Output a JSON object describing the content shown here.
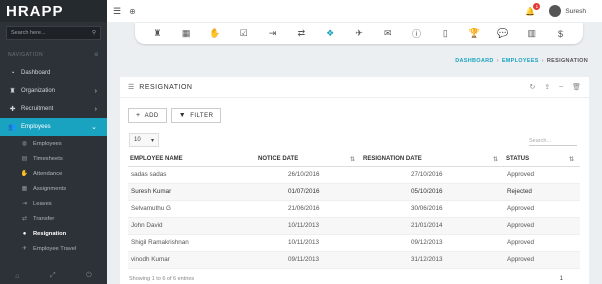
{
  "app": {
    "brand": "HRAPP"
  },
  "sidebar": {
    "search_placeholder": "Search here...",
    "nav_header": "NAVIGATION",
    "items": [
      {
        "label": "Dashboard"
      },
      {
        "label": "Organization"
      },
      {
        "label": "Recruitment"
      },
      {
        "label": "Employees"
      }
    ],
    "sub_items": [
      {
        "label": "Employees"
      },
      {
        "label": "Timesheets"
      },
      {
        "label": "Attendance"
      },
      {
        "label": "Assignments"
      },
      {
        "label": "Leaves"
      },
      {
        "label": "Transfer"
      },
      {
        "label": "Resignation"
      },
      {
        "label": "Employee Travel"
      }
    ]
  },
  "topbar": {
    "user_name": "Suresh",
    "notification_count": "1"
  },
  "breadcrumb": {
    "home": "DASHBOARD",
    "section": "EMPLOYEES",
    "current": "RESIGNATION"
  },
  "card": {
    "title": "RESIGNATION",
    "add_label": "ADD",
    "filter_label": "FILTER",
    "page_length": "10",
    "search_placeholder": "Search..."
  },
  "table": {
    "headers": [
      "EMPLOYEE NAME",
      "NOTICE DATE",
      "RESIGNATION DATE",
      "STATUS"
    ],
    "rows": [
      [
        "sadas sadas",
        "26/10/2016",
        "27/10/2016",
        "Approved"
      ],
      [
        "Suresh Kumar",
        "01/07/2016",
        "05/10/2016",
        "Rejected"
      ],
      [
        "Selvamuthu G",
        "21/06/2016",
        "30/06/2016",
        "Approved"
      ],
      [
        "John David",
        "10/11/2013",
        "21/01/2014",
        "Approved"
      ],
      [
        "Shigil Ramakrishnan",
        "10/11/2013",
        "09/12/2013",
        "Approved"
      ],
      [
        "vinodh Kumar",
        "09/11/2013",
        "31/12/2013",
        "Approved"
      ]
    ]
  },
  "footer": {
    "info": "Showing 1 to 6 of 6 entries",
    "page": "1"
  }
}
